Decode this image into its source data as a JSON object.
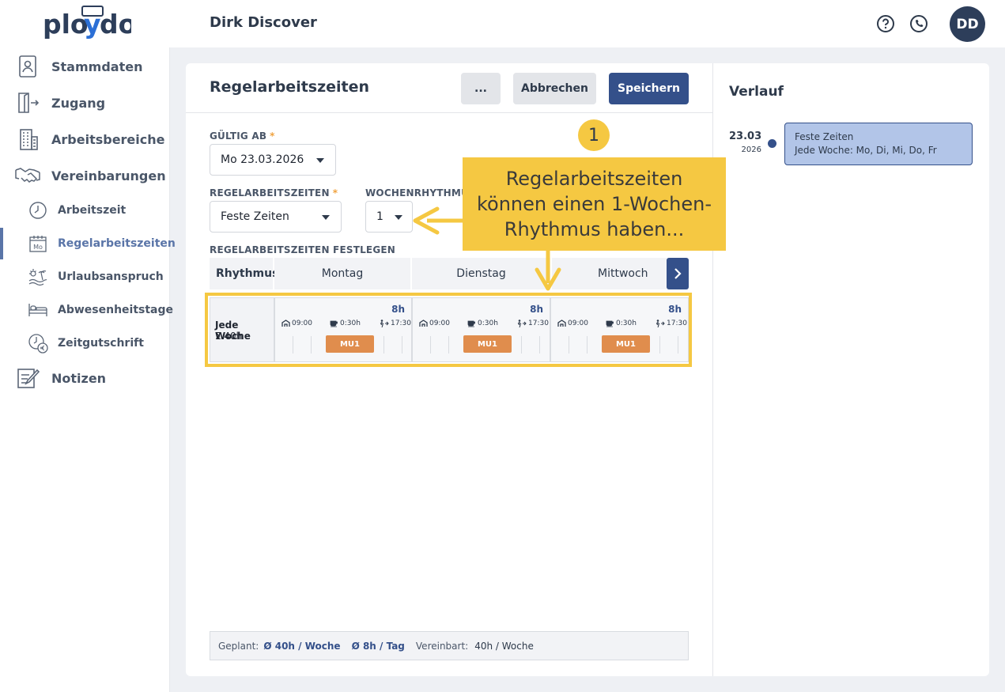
{
  "app": {
    "logo_text_a": "plo",
    "logo_text_y": "y",
    "logo_text_b": "do",
    "user_name": "Dirk Discover",
    "avatar_initials": "DD"
  },
  "sidebar": {
    "items": [
      {
        "label": "Stammdaten",
        "icon": "id-card-icon"
      },
      {
        "label": "Zugang",
        "icon": "door-enter-icon"
      },
      {
        "label": "Arbeitsbereiche",
        "icon": "building-icon"
      },
      {
        "label": "Vereinbarungen",
        "icon": "handshake-icon"
      },
      {
        "label": "Arbeitszeit",
        "icon": "clock-icon"
      },
      {
        "label": "Regelarbeitszeiten",
        "icon": "calendar-mo-icon",
        "active": true
      },
      {
        "label": "Urlaubsanspruch",
        "icon": "beach-icon"
      },
      {
        "label": "Abwesenheitstage",
        "icon": "bed-icon"
      },
      {
        "label": "Zeitgutschrift",
        "icon": "clock-euro-icon"
      },
      {
        "label": "Notizen",
        "icon": "notepad-icon"
      }
    ],
    "calendar_icon_text": "Mo"
  },
  "main": {
    "title": "Regelarbeitszeiten",
    "btn_more": "...",
    "btn_cancel": "Abbrechen",
    "btn_save": "Speichern",
    "gueltig_ab_label": "GÜLTIG AB",
    "gueltig_ab_value": "Mo 23.03.2026",
    "regel_label": "REGELARBEITSZEITEN",
    "regel_value": "Feste Zeiten",
    "required_mark": "*",
    "wochen_label": "WOCHENRHYTHMUS",
    "wochen_value": "1",
    "festlegen_label": "REGELARBEITSZEITEN FESTLEGEN",
    "table": {
      "head_rhythm": "Rhythmus",
      "days": [
        "Montag",
        "Dienstag",
        "Mittwoch"
      ],
      "row_label": "Jede Woche",
      "row_sum": "Σ 40h",
      "cells": [
        {
          "hours": "8h",
          "start": "09:00",
          "pause": "0:30h",
          "end": "17:30",
          "badge": "MU1"
        },
        {
          "hours": "8h",
          "start": "09:00",
          "pause": "0:30h",
          "end": "17:30",
          "badge": "MU1"
        },
        {
          "hours": "8h",
          "start": "09:00",
          "pause": "0:30h",
          "end": "17:30",
          "badge": "MU1"
        }
      ]
    },
    "summary": {
      "geplant_label": "Geplant:",
      "per_week": "Ø 40h / Woche",
      "per_day": "Ø 8h / Tag",
      "vereinbart_label": "Vereinbart:",
      "vereinbart_value": "40h / Woche"
    }
  },
  "verlauf": {
    "title": "Verlauf",
    "entry": {
      "date": "23.03",
      "year": "2026",
      "line1": "Feste Zeiten",
      "line2": "Jede Woche: Mo, Di, Mi, Do, Fr"
    }
  },
  "annotation": {
    "number": "1",
    "line1": "Regelarbeitszeiten",
    "line2": "können einen 1-Wochen-",
    "line3": "Rhythmus haben..."
  },
  "colors": {
    "primary": "#34508a",
    "accent_yellow": "#f5c842",
    "badge_orange": "#e08d4d",
    "history_card": "#b2c5e8"
  }
}
